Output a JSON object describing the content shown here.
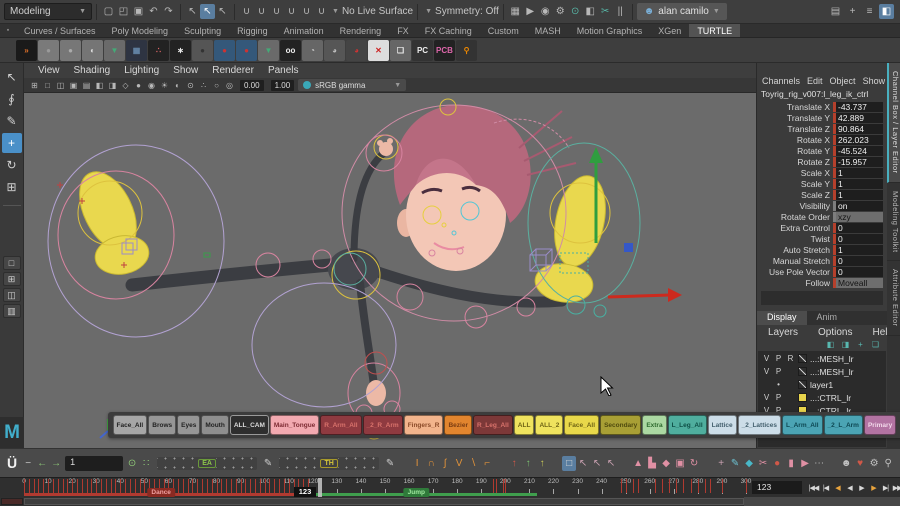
{
  "app": {
    "logo": "M"
  },
  "titlebar": {
    "menuset": "Modeling",
    "file_icons": [
      {
        "n": "new-scene-icon",
        "g": "▢"
      },
      {
        "n": "open-scene-icon",
        "g": "◰"
      },
      {
        "n": "save-scene-icon",
        "g": "▣"
      },
      {
        "n": "undo-icon",
        "g": "↶"
      },
      {
        "n": "redo-icon",
        "g": "↷"
      }
    ],
    "select_icons": [
      {
        "n": "select-hierarchy-icon",
        "g": "↖"
      },
      {
        "n": "select-object-icon",
        "g": "↖",
        "active": true
      },
      {
        "n": "select-component-icon",
        "g": "↖"
      }
    ],
    "snap_icons": [
      {
        "n": "snap-grid-icon",
        "g": "∪"
      },
      {
        "n": "snap-curve-icon",
        "g": "∪"
      },
      {
        "n": "snap-point-icon",
        "g": "∪"
      },
      {
        "n": "snap-projected-center-icon",
        "g": "∪"
      },
      {
        "n": "snap-view-plane-icon",
        "g": "∪"
      },
      {
        "n": "make-live-icon",
        "g": "∪"
      }
    ],
    "live_surface": "No Live Surface",
    "symmetry": "Symmetry: Off",
    "render_icons": [
      {
        "n": "render-view-icon",
        "g": "▦"
      },
      {
        "n": "render-frame-icon",
        "g": "▶"
      },
      {
        "n": "ipr-render-icon",
        "g": "◉"
      },
      {
        "n": "render-settings-icon",
        "g": "⚙"
      },
      {
        "n": "hypershade-icon",
        "g": "⊙",
        "c": "#58b8a8"
      },
      {
        "n": "light-editor-icon",
        "g": "◧"
      },
      {
        "n": "cut-faces-icon",
        "g": "✂",
        "c": "#58b8a8"
      },
      {
        "n": "pause-viewport-icon",
        "g": "||"
      }
    ],
    "user": "alan camilo",
    "person_icon": "☻",
    "right_icons": [
      {
        "n": "raise-panels-icon",
        "g": "▤"
      },
      {
        "n": "pin-menus-icon",
        "g": "+"
      },
      {
        "n": "hotbox-icon",
        "g": "≡"
      },
      {
        "n": "workspace-icon",
        "g": "◧",
        "active": true
      }
    ]
  },
  "menu_tabs": {
    "items": [
      "Curves / Surfaces",
      "Poly Modeling",
      "Sculpting",
      "Rigging",
      "Animation",
      "Rendering",
      "FX",
      "FX Caching",
      "Custom",
      "MASH",
      "Motion Graphics",
      "XGen",
      "TURTLE"
    ],
    "active": "TURTLE",
    "corner_icon": "▪"
  },
  "shelf": {
    "items": [
      {
        "n": "shelf-goldfish-icon",
        "g": "»",
        "bg": "#1a1a1a",
        "c": "#e07028"
      },
      {
        "n": "shelf-sphere-icon",
        "g": "●",
        "bg": "#7a7a7a",
        "c": "#9a9a9a"
      },
      {
        "n": "shelf-sphere2-icon",
        "g": "●",
        "bg": "#777777",
        "c": "#ababab"
      },
      {
        "n": "shelf-sphere3-icon",
        "g": "◐",
        "bg": "#757575",
        "c": "#dddddd"
      },
      {
        "n": "shelf-green-arrow-icon",
        "g": "▼",
        "bg": "#6a6a6a",
        "c": "#44aa77"
      },
      {
        "n": "shelf-blue-grid-icon",
        "g": "▦",
        "bg": "#2e3442",
        "c": "#6688aa"
      },
      {
        "n": "shelf-pink-dots-icon",
        "g": "∴",
        "bg": "#222222",
        "c": "#dd6666"
      },
      {
        "n": "shelf-snow-icon",
        "g": "∗",
        "bg": "#222222",
        "c": "#eeeeee"
      },
      {
        "n": "shelf-pressed-sphere-icon",
        "g": "●",
        "bg": "#555555",
        "c": "#333333"
      },
      {
        "n": "shelf-redball-icon",
        "g": "●",
        "bg": "#34587a",
        "c": "#cc3333"
      },
      {
        "n": "shelf-redball2-icon",
        "g": "●",
        "bg": "#34587a",
        "c": "#cc3333"
      },
      {
        "n": "shelf-green-arrow2-icon",
        "g": "▼",
        "bg": "#6a6a6a",
        "c": "#44aa77"
      },
      {
        "n": "shelf-goggles-icon",
        "g": "oo",
        "bg": "#222222",
        "c": "#eeeeee"
      },
      {
        "n": "shelf-pie-icon",
        "g": "◔",
        "bg": "#666666",
        "c": "#cccccc"
      },
      {
        "n": "shelf-pie2-icon",
        "g": "◕",
        "bg": "#565656",
        "c": "#bbbbbb"
      },
      {
        "n": "shelf-redpie-icon",
        "g": "◕",
        "bg": "#444444",
        "c": "#cc3333"
      },
      {
        "n": "shelf-redx-icon",
        "g": "✕",
        "bg": "#dddddd",
        "c": "#cc2222"
      },
      {
        "n": "shelf-cube-icon",
        "g": "❏",
        "bg": "#666666",
        "c": "#eeeeee"
      },
      {
        "n": "shelf-pc-icon",
        "g": "PC",
        "bg": "#333333",
        "c": "#eeeeee"
      },
      {
        "n": "shelf-pcb-icon",
        "g": "PCB",
        "bg": "#222222",
        "c": "#dd66aa"
      },
      {
        "n": "shelf-magnify-icon",
        "g": "⚲",
        "bg": "#333333",
        "c": "#ee8800"
      }
    ]
  },
  "toolbox": {
    "tools": [
      {
        "n": "select-tool-icon",
        "g": "↖"
      },
      {
        "n": "lasso-tool-icon",
        "g": "∮"
      },
      {
        "n": "paint-select-tool-icon",
        "g": "✎"
      },
      {
        "n": "move-tool-icon",
        "g": "+",
        "active": true
      },
      {
        "n": "rotate-tool-icon",
        "g": "↻"
      },
      {
        "n": "scale-tool-icon",
        "g": "⊞"
      }
    ],
    "layouts": [
      {
        "n": "layout-single-pane-icon",
        "g": "□"
      },
      {
        "n": "layout-four-pane-icon",
        "g": "⊞"
      },
      {
        "n": "layout-two-pane-icon",
        "g": "◫"
      },
      {
        "n": "layout-outliner-pane-icon",
        "g": "▥"
      }
    ]
  },
  "viewport": {
    "menus": [
      "View",
      "Shading",
      "Lighting",
      "Show",
      "Renderer",
      "Panels"
    ],
    "bar_icons": [
      {
        "n": "vp-grid-icon",
        "g": "⊞"
      },
      {
        "n": "vp-film-gate-icon",
        "g": "□"
      },
      {
        "n": "vp-res-gate-icon",
        "g": "◫"
      },
      {
        "n": "vp-gate-mask-icon",
        "g": "▣"
      },
      {
        "n": "vp-field-chart-icon",
        "g": "▤"
      },
      {
        "n": "vp-safe-action-icon",
        "g": "◧"
      },
      {
        "n": "vp-safe-title-icon",
        "g": "◨"
      },
      {
        "n": "vp-wireframe-icon",
        "g": "◇"
      },
      {
        "n": "vp-shaded-icon",
        "g": "●"
      },
      {
        "n": "vp-textured-icon",
        "g": "◉"
      },
      {
        "n": "vp-lights-icon",
        "g": "☀"
      },
      {
        "n": "vp-shadows-icon",
        "g": "◐"
      },
      {
        "n": "vp-ao-icon",
        "g": "⊙"
      },
      {
        "n": "vp-multisample-icon",
        "g": "∴"
      },
      {
        "n": "vp-isolate-icon",
        "g": "○"
      },
      {
        "n": "vp-xray-icon",
        "g": "◎"
      }
    ],
    "exposure": "0.00",
    "gamma": "1.00",
    "colorspace": "sRGB gamma"
  },
  "channel_box": {
    "menus": [
      "Channels",
      "Edit",
      "Object",
      "Show"
    ],
    "object_name": "Toyrig_rig_v007:l_leg_ik_ctrl",
    "channels": [
      {
        "label": "Translate X",
        "value": "-43.737",
        "bar": "red",
        "enum": false
      },
      {
        "label": "Translate Y",
        "value": "42.889",
        "bar": "red",
        "enum": false
      },
      {
        "label": "Translate Z",
        "value": "90.864",
        "bar": "red",
        "enum": false
      },
      {
        "label": "Rotate X",
        "value": "262.023",
        "bar": "red",
        "enum": false
      },
      {
        "label": "Rotate Y",
        "value": "-45.524",
        "bar": "red",
        "enum": false
      },
      {
        "label": "Rotate Z",
        "value": "-15.957",
        "bar": "red",
        "enum": false
      },
      {
        "label": "Scale X",
        "value": "1",
        "bar": "red",
        "enum": false
      },
      {
        "label": "Scale Y",
        "value": "1",
        "bar": "red",
        "enum": false
      },
      {
        "label": "Scale Z",
        "value": "1",
        "bar": "red",
        "enum": false
      },
      {
        "label": "Visibility",
        "value": "on",
        "bar": "gray",
        "enum": false
      },
      {
        "label": "Rotate Order",
        "value": "xzy",
        "bar": "gray",
        "enum": true
      },
      {
        "label": "Extra Control",
        "value": "0",
        "bar": "red",
        "enum": false
      },
      {
        "label": "Twist",
        "value": "0",
        "bar": "red",
        "enum": false
      },
      {
        "label": "Auto Stretch",
        "value": "1",
        "bar": "red",
        "enum": false
      },
      {
        "label": "Manual Stretch",
        "value": "0",
        "bar": "red",
        "enum": false
      },
      {
        "label": "Use Pole Vector",
        "value": "0",
        "bar": "red",
        "enum": false
      },
      {
        "label": "Follow",
        "value": "Moveall",
        "bar": "red",
        "enum": true
      }
    ]
  },
  "layer_editor": {
    "tabs": [
      "Display",
      "Anim"
    ],
    "active_tab": "Display",
    "menus": [
      "Layers",
      "Options",
      "Help"
    ],
    "icons": [
      {
        "n": "move-layer-up-icon",
        "g": "◧"
      },
      {
        "n": "move-layer-down-icon",
        "g": "◨"
      },
      {
        "n": "new-empty-layer-icon",
        "g": "+"
      },
      {
        "n": "new-layer-from-selected-icon",
        "g": "❏"
      }
    ],
    "layers": [
      {
        "v": "V",
        "p": "P",
        "r": "R",
        "swatch": "ramp",
        "name": "...:MESH_lr",
        "dot": false
      },
      {
        "v": "V",
        "p": "P",
        "r": "",
        "swatch": "ramp",
        "name": "...:MESH_lr",
        "dot": false
      },
      {
        "v": "",
        "p": "",
        "r": "",
        "swatch": "ramp",
        "name": "layer1",
        "dot": true
      },
      {
        "v": "V",
        "p": "P",
        "r": "",
        "swatch": "#e8d44c",
        "name": "...:CTRL_lr",
        "dot": false
      },
      {
        "v": "V",
        "p": "P",
        "r": "",
        "swatch": "#e8d44c",
        "name": "...:CTRL_lr",
        "dot": false
      }
    ]
  },
  "side_tabs": {
    "items": [
      "Channel Box / Layer Editor",
      "Modeling Toolkit",
      "Attribute Editor"
    ],
    "active_index": 0
  },
  "picker": {
    "buttons": [
      {
        "label": "Face_All",
        "bg": "#a6a6a6",
        "fg": "#222222"
      },
      {
        "label": "Brows",
        "bg": "#969696",
        "fg": "#222222"
      },
      {
        "label": "Eyes",
        "bg": "#969696",
        "fg": "#222222"
      },
      {
        "label": "Mouth",
        "bg": "#8e8e8e",
        "fg": "#222222"
      },
      {
        "label": "ALL_CAM",
        "bg": "#2e2e2e",
        "fg": "#dddddd",
        "border": "#999999"
      },
      {
        "label": "Main_Tongue",
        "bg": "#f2a9b0",
        "fg": "#7c2a32"
      },
      {
        "label": "R_Arm_All",
        "bg": "#8f3a40",
        "fg": "#d9736c"
      },
      {
        "label": "_2_R_Arm",
        "bg": "#8f3a40",
        "fg": "#d9736c"
      },
      {
        "label": "Fingers_R",
        "bg": "#f2b48c",
        "fg": "#8a4a28"
      },
      {
        "label": "Bezier",
        "bg": "#e2852e",
        "fg": "#7a3c12"
      },
      {
        "label": "R_Leg_All",
        "bg": "#7c3838",
        "fg": "#d9736c"
      },
      {
        "label": "ALL",
        "bg": "#efe35e",
        "fg": "#6f6414"
      },
      {
        "label": "ALL_2",
        "bg": "#efe35e",
        "fg": "#6f6414"
      },
      {
        "label": "Face_All",
        "bg": "#e8d84a",
        "fg": "#6f6414"
      },
      {
        "label": "Secondary",
        "bg": "#a89f35",
        "fg": "#4f4a0e"
      },
      {
        "label": "Extra",
        "bg": "#abd8a2",
        "fg": "#2f6b2f"
      },
      {
        "label": "L_Leg_All",
        "bg": "#4fae9e",
        "fg": "#0e4f46"
      },
      {
        "label": "Lattice",
        "bg": "#ccdde8",
        "fg": "#44606e"
      },
      {
        "label": "_2_Lattices",
        "bg": "#ccdde8",
        "fg": "#44606e"
      },
      {
        "label": "L_Arm_All",
        "bg": "#4ba4b4",
        "fg": "#0d4752"
      },
      {
        "label": "_2_L_Arm",
        "bg": "#4ba4b4",
        "fg": "#0d4752"
      },
      {
        "label": "Primary",
        "bg": "#b273a2",
        "fg": "#f2d8ea"
      }
    ],
    "icons": [
      {
        "n": "save-picker-icon",
        "g": "▣",
        "c": "#d8b88a"
      },
      {
        "n": "copy-picker-icon",
        "g": "▣",
        "c": "#c8a0a8"
      },
      {
        "n": "paste-picker-icon",
        "g": "▣",
        "c": "#d8b88a"
      }
    ],
    "close": "✕"
  },
  "animbot": {
    "frame": "1",
    "slider1": "EA",
    "slider2": "TH",
    "left_icons": [
      {
        "n": "animbot-minimize-icon",
        "g": "−",
        "c": "#cccccc"
      },
      {
        "n": "prev-key-arrow-icon",
        "g": "←",
        "c": "#8fc978"
      },
      {
        "n": "next-key-arrow-icon",
        "g": "→",
        "c": "#8fc978"
      }
    ],
    "mid_icons": [
      {
        "n": "power-icon",
        "g": "⊙",
        "c": "#8fc978"
      },
      {
        "n": "dots-grid-icon",
        "g": "∷",
        "c": "#8fc978"
      }
    ],
    "pen1": [
      {
        "n": "tweak-pen-icon",
        "g": "✎",
        "c": "#cccccc"
      }
    ],
    "pen2": [
      {
        "n": "tweak-pen2-icon",
        "g": "✎",
        "c": "#cccccc"
      }
    ],
    "tangent_icons": [
      {
        "n": "tangent-linear-icon",
        "g": "I",
        "c": "#e0923a"
      },
      {
        "n": "tangent-smooth-icon",
        "g": "∩",
        "c": "#e0923a"
      },
      {
        "n": "tangent-spline-icon",
        "g": "∫",
        "c": "#e0923a"
      },
      {
        "n": "tangent-vee-icon",
        "g": "V",
        "c": "#e0923a"
      },
      {
        "n": "tangent-slope-icon",
        "g": "∖",
        "c": "#e0923a"
      },
      {
        "n": "tangent-step-icon",
        "g": "⌐",
        "c": "#e0923a"
      }
    ],
    "key_icons": [
      {
        "n": "key-red-icon",
        "g": "↑",
        "c": "#d05848"
      },
      {
        "n": "key-green-icon",
        "g": "↑",
        "c": "#7ac070"
      },
      {
        "n": "key-yellow-icon",
        "g": "↑",
        "c": "#c8c858"
      }
    ],
    "cursor_icons": [
      {
        "n": "select-box-icon",
        "g": "□",
        "c": "#d8d8d8",
        "active": true
      },
      {
        "n": "cursor-a-icon",
        "g": "↖",
        "c": "#c8a0b0"
      },
      {
        "n": "cursor-b-icon",
        "g": "↖",
        "c": "#c8a0b0"
      },
      {
        "n": "cursor-c-icon",
        "g": "↖",
        "c": "#c8a0b0"
      }
    ],
    "pink_icons": [
      {
        "n": "anim-ghost-icon",
        "g": "▲",
        "c": "#e090a4"
      },
      {
        "n": "anim-blocks-icon",
        "g": "▙",
        "c": "#e090a4"
      },
      {
        "n": "anim-keys-icon",
        "g": "◆",
        "c": "#e090a4"
      },
      {
        "n": "anim-copy-icon",
        "g": "▣",
        "c": "#e090a4"
      },
      {
        "n": "anim-flip-icon",
        "g": "↻",
        "c": "#e090a4"
      }
    ],
    "tool_icons": [
      {
        "n": "pivot-icon",
        "g": "+",
        "c": "#c8a0b0"
      },
      {
        "n": "pen-tool-icon",
        "g": "✎",
        "c": "#6cc0d0"
      },
      {
        "n": "diamond-icon",
        "g": "◆",
        "c": "#49b8c8"
      },
      {
        "n": "scissors-icon",
        "g": "✂",
        "c": "#e090a4"
      },
      {
        "n": "record-icon",
        "g": "●",
        "c": "#d05848"
      },
      {
        "n": "bookmark-icon",
        "g": "▮",
        "c": "#e090a4"
      },
      {
        "n": "play-key-icon",
        "g": "▶",
        "c": "#e090a4"
      },
      {
        "n": "more-icon",
        "g": "⋯",
        "c": "#bbbbbb"
      }
    ],
    "right_icons": [
      {
        "n": "pose-library-icon",
        "g": "☻",
        "c": "#c0c0c0"
      },
      {
        "n": "favorites-heart-icon",
        "g": "♥",
        "c": "#d05848"
      },
      {
        "n": "settings-gear-icon",
        "g": "⚙",
        "c": "#c0c0c0"
      },
      {
        "n": "search-icon",
        "g": "⚲",
        "c": "#c0c0c0"
      }
    ]
  },
  "timeline": {
    "start": 0,
    "end": 300,
    "label_step": 10,
    "current": 123,
    "frame_field": "123",
    "keys_dense": {
      "from": 0,
      "to": 118,
      "step": 2
    },
    "keys_sparse": [
      195,
      196,
      199,
      200,
      248,
      250,
      253,
      255,
      262,
      265,
      268,
      271,
      274,
      277,
      280,
      283,
      285,
      290,
      300
    ],
    "bookmarks": [
      {
        "label": "Dance",
        "from": 0,
        "to": 118,
        "bar": "#b03a30",
        "bg": "#8a2a22",
        "fg": "#f0a0a0",
        "label_frame": 57
      },
      {
        "label": "Jump",
        "from": 118,
        "to": 213,
        "bar": "#3f9e4d",
        "bg": "#2f7a3a",
        "fg": "#a0e8a0",
        "label_frame": 163
      }
    ],
    "playback": [
      {
        "n": "go-to-start-button",
        "g": "|◀◀"
      },
      {
        "n": "step-back-frame-button",
        "g": "|◀"
      },
      {
        "n": "step-back-key-button",
        "g": "◀",
        "c": "#e8a33d"
      },
      {
        "n": "play-backwards-button",
        "g": "◀"
      },
      {
        "n": "play-forwards-button",
        "g": "▶"
      },
      {
        "n": "step-forward-key-button",
        "g": "▶",
        "c": "#e8a33d"
      },
      {
        "n": "step-forward-frame-button",
        "g": "▶|"
      },
      {
        "n": "go-to-end-button",
        "g": "▶▶|"
      }
    ]
  }
}
